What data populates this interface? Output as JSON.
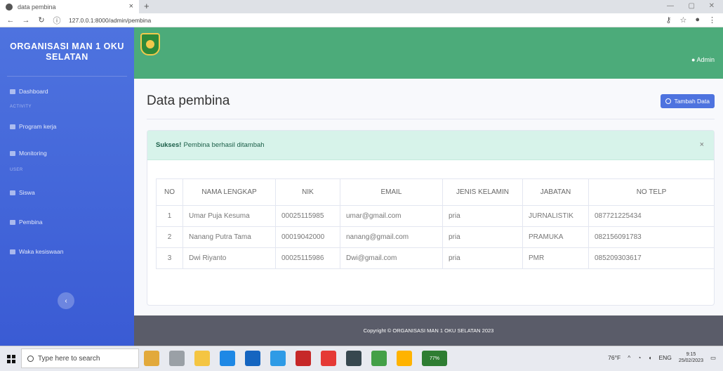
{
  "browser": {
    "tab_title": "data pembina",
    "url": "127.0.0.1:8000/admin/pembina"
  },
  "sidebar": {
    "brand": "ORGANISASI MAN 1 OKU SELATAN",
    "items": [
      {
        "label": "Dashboard"
      },
      {
        "heading": "ACTIVITY"
      },
      {
        "label": "Program kerja"
      },
      {
        "label": "Monitoring"
      },
      {
        "heading": "USER"
      },
      {
        "label": "Siswa"
      },
      {
        "label": "Pembina"
      },
      {
        "label": "Waka kesiswaan"
      }
    ]
  },
  "topbar": {
    "user": "Admin"
  },
  "page": {
    "title": "Data pembina",
    "add_button": "Tambah Data",
    "alert_strong": "Sukses!",
    "alert_text": "Pembina berhasil ditambah"
  },
  "table": {
    "headers": [
      "NO",
      "NAMA LENGKAP",
      "NIK",
      "EMAIL",
      "JENIS KELAMIN",
      "JABATAN",
      "NO TELP"
    ],
    "rows": [
      [
        "1",
        "Umar Puja Kesuma",
        "00025115985",
        "umar@gmail.com",
        "pria",
        "JURNALISTIK",
        "087721225434"
      ],
      [
        "2",
        "Nanang Putra Tama",
        "00019042000",
        "nanang@gmail.com",
        "pria",
        "PRAMUKA",
        "082156091783"
      ],
      [
        "3",
        "Dwi Riyanto",
        "00025115986",
        "Dwi@gmail.com",
        "pria",
        "PMR",
        "085209303617"
      ]
    ]
  },
  "footer": {
    "text": "Copyright © ORGANISASI MAN 1 OKU SELATAN 2023"
  },
  "taskbar": {
    "search_placeholder": "Type here to search",
    "battery": "77%",
    "weather": "76°F",
    "lang": "ENG",
    "time": "9:15",
    "date": "25/02/2023"
  },
  "colors": {
    "sidebar": "#4e73df",
    "topbar": "#4cab7a",
    "alert": "#d7f3ea",
    "footer": "#5a5c69"
  }
}
